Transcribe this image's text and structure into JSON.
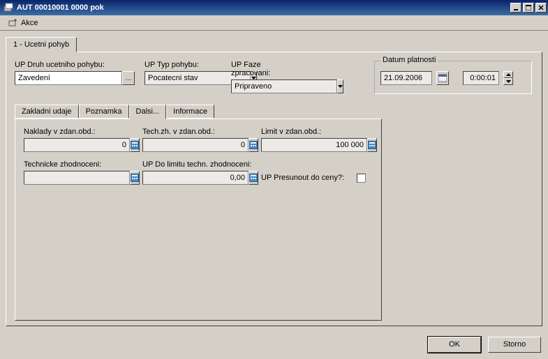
{
  "window": {
    "title": "AUT 00010001 0000 pok"
  },
  "menu": {
    "akce": "Akce"
  },
  "main_tabs": {
    "ucetni_pohyb": "1 - Ucetni pohyb"
  },
  "labels": {
    "druh": "UP Druh ucetniho pohybu:",
    "typ": "UP Typ pohybu:",
    "faze": "UP Faze zpracovani:",
    "datum_platnosti": "Datum platnosti"
  },
  "values": {
    "druh": "Zavedení",
    "typ": "Pocatecni stav",
    "faze": "Pripraveno",
    "date": "21.09.2006",
    "time": "0:00:01"
  },
  "sub_tabs": {
    "zakladni": "Zakladni udaje",
    "poznamka": "Poznamka",
    "dalsi": "Dalsi...",
    "informace": "Informace"
  },
  "dalsi": {
    "naklady_label": "Naklady v zdan.obd.:",
    "naklady_value": "0",
    "techzh_label": "Tech.zh. v zdan.obd.:",
    "techzh_value": "0",
    "limit_label": "Limit v zdan.obd.:",
    "limit_value": "100 000",
    "technicke_label": "Technicke zhodnoceni:",
    "technicke_value": "",
    "dolimitu_label": "UP Do limitu techn. zhodnoceni:",
    "dolimitu_value": "0,00",
    "presunout_label": "UP Presunout do ceny?:"
  },
  "footer": {
    "ok": "OK",
    "storno": "Storno"
  }
}
